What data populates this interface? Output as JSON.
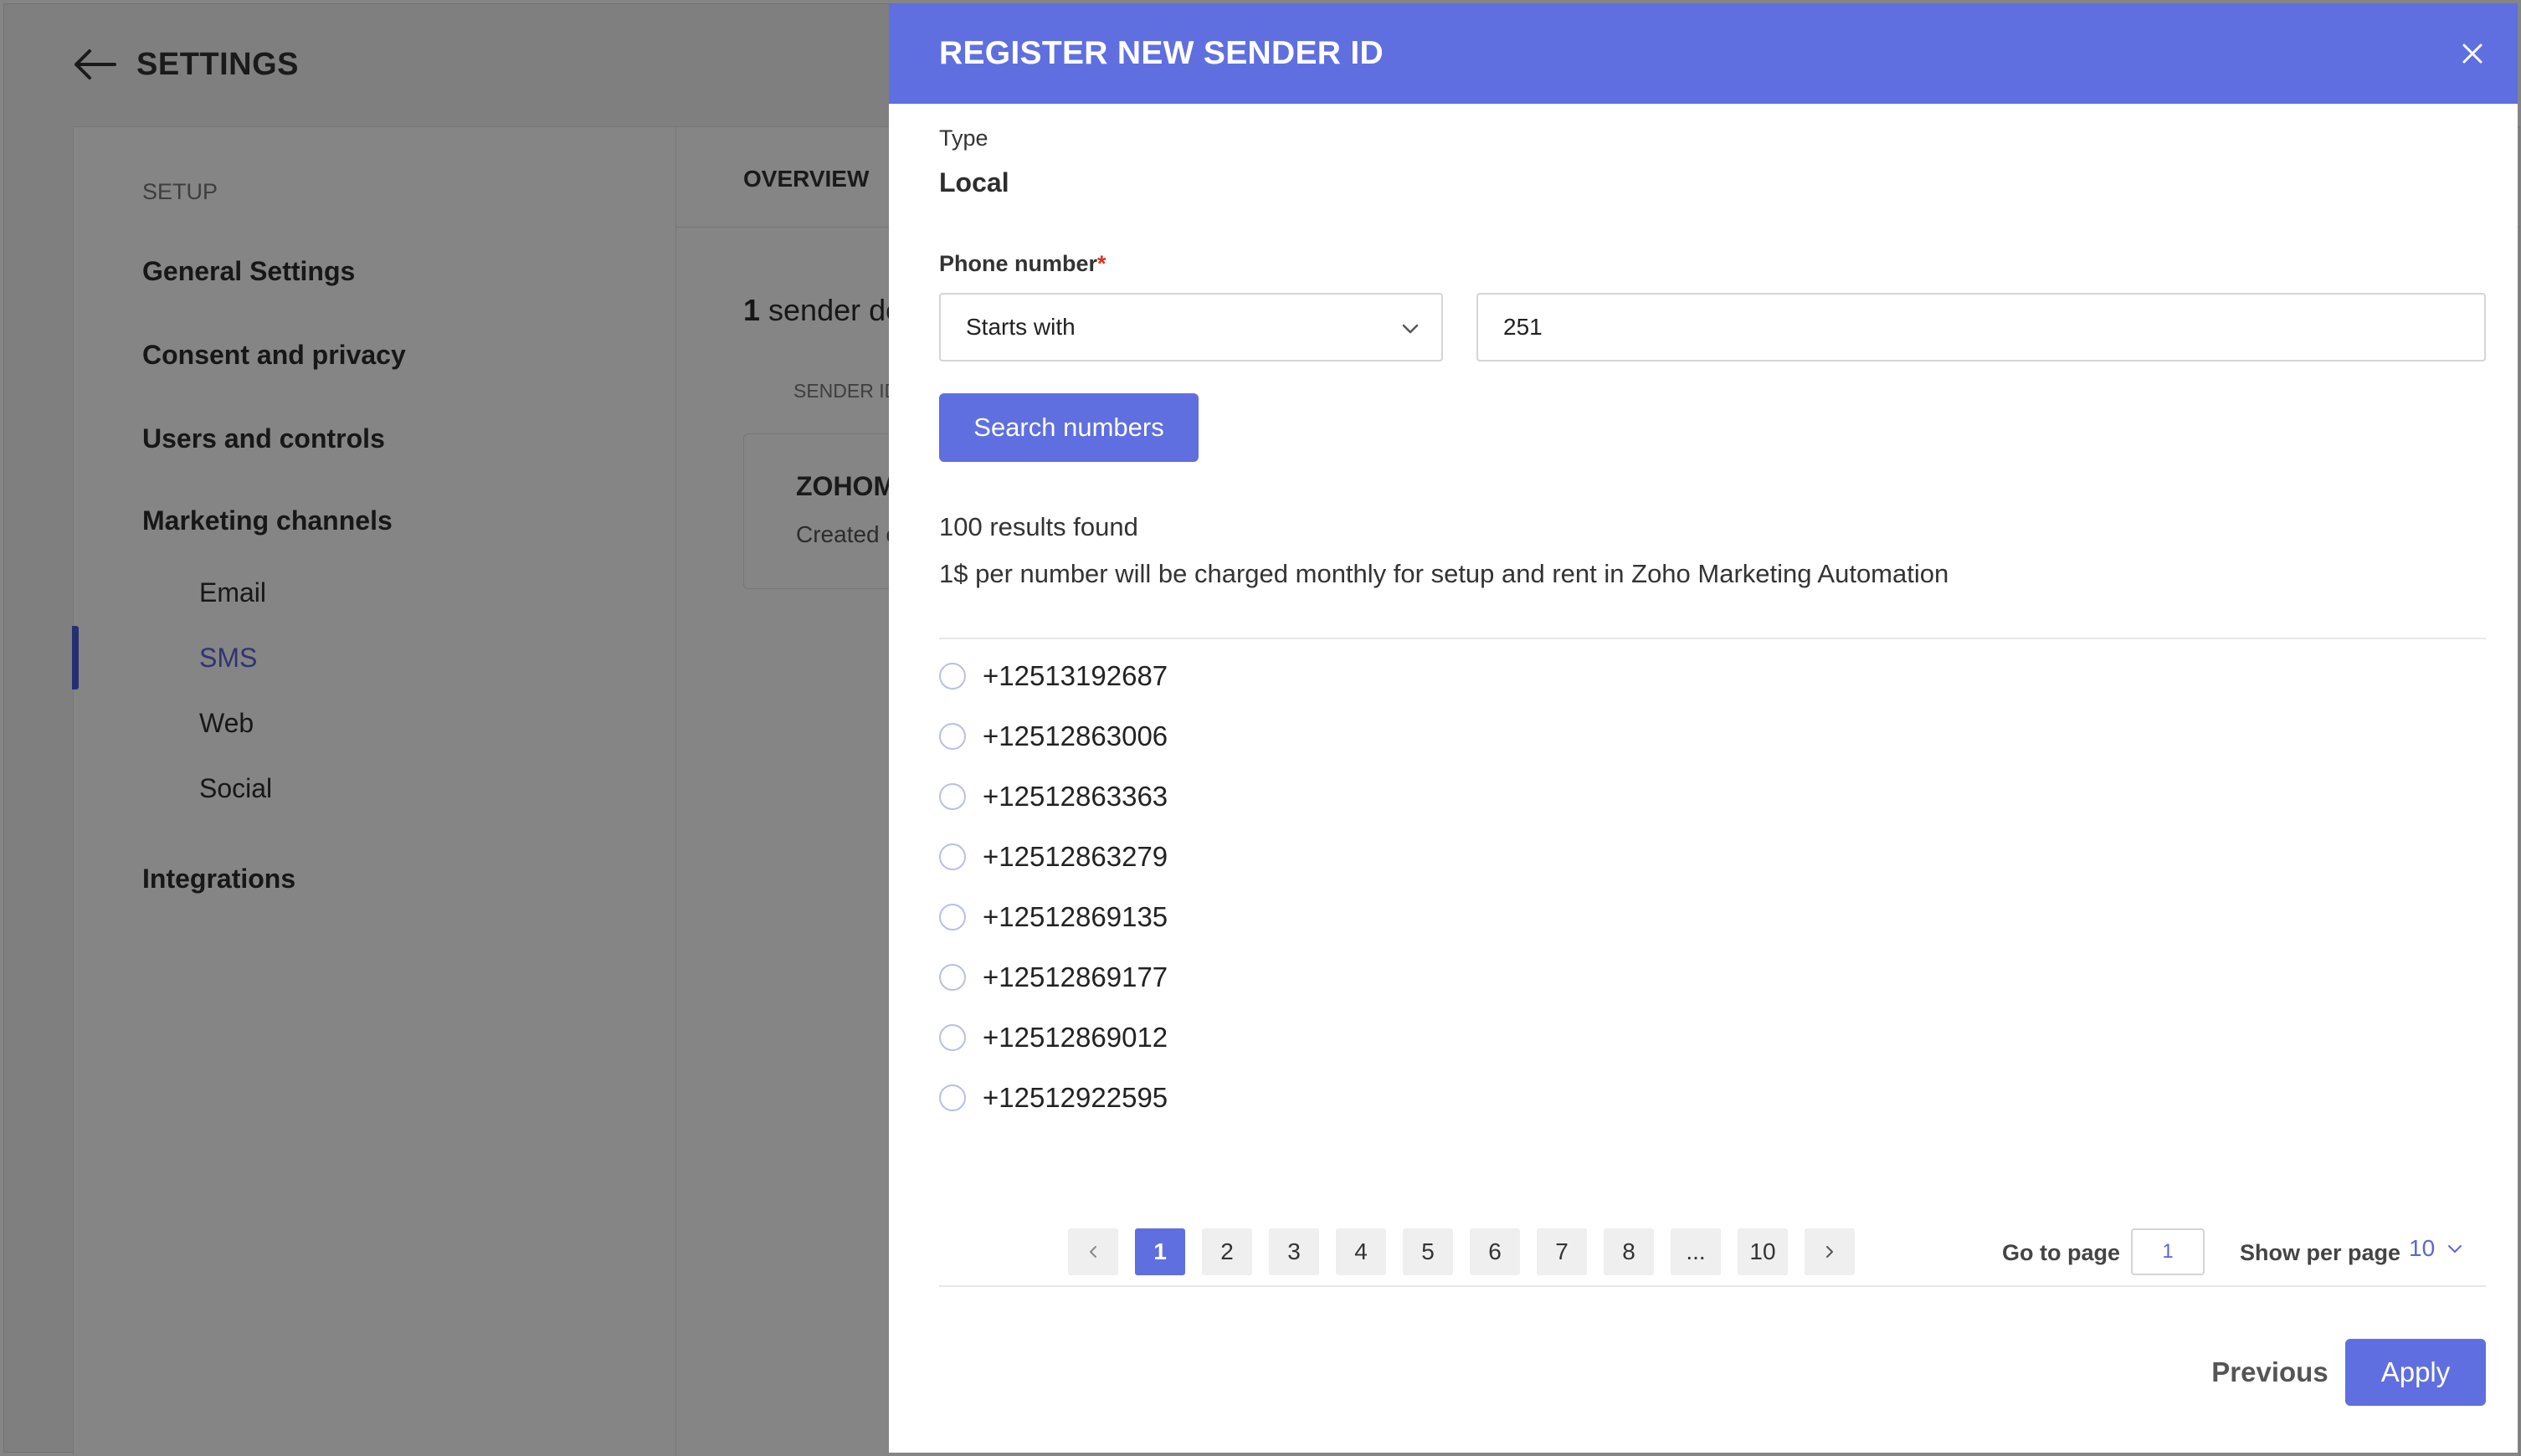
{
  "background": {
    "title": "SETTINGS",
    "sidebar": {
      "heading": "SETUP",
      "items": [
        {
          "label": "General Settings"
        },
        {
          "label": "Consent and privacy"
        },
        {
          "label": "Users and controls"
        },
        {
          "label": "Marketing channels"
        }
      ],
      "sub_items": [
        {
          "label": "Email"
        },
        {
          "label": "SMS"
        },
        {
          "label": "Web"
        },
        {
          "label": "Social"
        }
      ],
      "integrations": "Integrations"
    },
    "tab_overview": "OVERVIEW",
    "sender_count_num": "1",
    "sender_count_rest": " sender de",
    "column_header": "SENDER ID",
    "card_title": "ZOHOM",
    "card_subtitle": "Created o"
  },
  "modal": {
    "title": "REGISTER NEW SENDER ID",
    "type_label": "Type",
    "type_value": "Local",
    "phone_label": "Phone number",
    "required_mark": "*",
    "match_mode": "Starts with",
    "phone_value": "251",
    "search_button": "Search numbers",
    "results_count": "100 results found",
    "charge_note": "1$ per number will be charged monthly for setup and rent in Zoho Marketing Automation",
    "numbers": [
      "+12513192687",
      "+12512863006",
      "+12512863363",
      "+12512863279",
      "+12512869135",
      "+12512869177",
      "+12512869012",
      "+12512922595"
    ],
    "pagination": {
      "pages": [
        "1",
        "2",
        "3",
        "4",
        "5",
        "6",
        "7",
        "8",
        "...",
        "10"
      ],
      "current": "1",
      "go_to_label": "Go to page",
      "go_to_value": "1",
      "per_page_label": "Show per page",
      "per_page_value": "10"
    },
    "previous_button": "Previous",
    "apply_button": "Apply"
  },
  "colors": {
    "accent": "#5f6fe0",
    "active_nav": "#5a65d8",
    "overlay": "rgba(0,0,0,0.48)"
  }
}
